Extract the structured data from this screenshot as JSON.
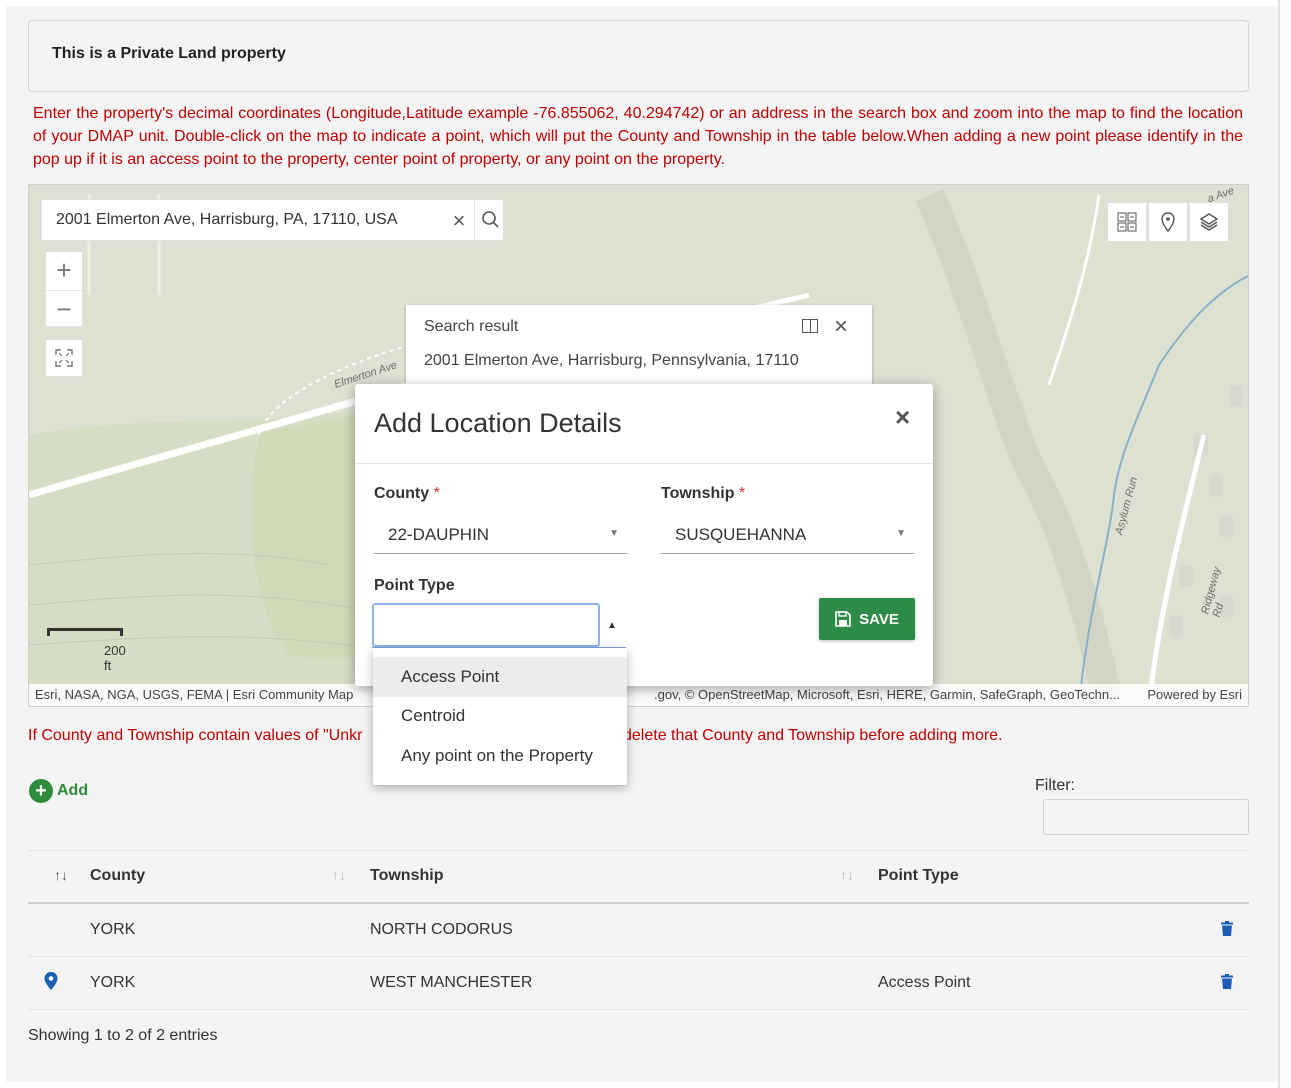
{
  "private_notice": "This is a Private Land property",
  "instructions": "Enter the property's decimal coordinates (Longitude,Latitude example -76.855062, 40.294742) or an address in the search box and zoom into the map to find the location of your DMAP unit. Double-click on the map to indicate a point, which will put the County and Township in the table below.When adding a new point please identify in the pop up if it is an access point to the property, center point of property, or any point on the property.",
  "map": {
    "search_value": "2001 Elmerton Ave, Harrisburg, PA, 17110, USA",
    "clear_icon": "close-icon",
    "search_icon": "search-icon",
    "zoom_in": "+",
    "zoom_out": "−",
    "fullscreen_icon": "expand-icon",
    "tools": [
      "basemap-gallery-icon",
      "locate-icon",
      "layers-icon"
    ],
    "scale_label": "200 ft",
    "street_labels": [
      "Elmerton Ave",
      "Asylum Run",
      "Ridgeway Rd",
      "a Ave"
    ],
    "attribution_left": "Esri, NASA, NGA, USGS, FEMA | Esri Community Map",
    "attribution_mid": ".gov, © OpenStreetMap, Microsoft, Esri, HERE, Garmin, SafeGraph, GeoTechn...",
    "attribution_right": "Powered by Esri",
    "search_result": {
      "title": "Search result",
      "address": "2001 Elmerton Ave, Harrisburg, Pennsylvania, 17110"
    }
  },
  "county_note_part1": "If County and Township contain values of \"Unkr",
  "county_note_part2": "delete that County and Township before adding more.",
  "add_label": "Add",
  "filter_label": "Filter:",
  "table": {
    "headers": [
      "County",
      "Township",
      "Point Type"
    ],
    "rows": [
      {
        "county": "YORK",
        "township": "NORTH CODORUS",
        "point_type": ""
      },
      {
        "county": "YORK",
        "township": "WEST MANCHESTER",
        "point_type": "Access Point"
      }
    ]
  },
  "showing": "Showing 1 to 2 of 2 entries",
  "modal": {
    "title": "Add Location Details",
    "close": "×",
    "county_label": "County",
    "county_value": "22-DAUPHIN",
    "township_label": "Township",
    "township_value": "SUSQUEHANNA",
    "required_mark": "*",
    "point_type_label": "Point Type",
    "point_type_value": "",
    "save_label": "SAVE",
    "options": [
      "Access Point",
      "Centroid",
      "Any point on the Property"
    ]
  },
  "colors": {
    "warning_red": "#c00000",
    "save_green": "#2e8b47",
    "icon_blue": "#1a5fb4"
  }
}
